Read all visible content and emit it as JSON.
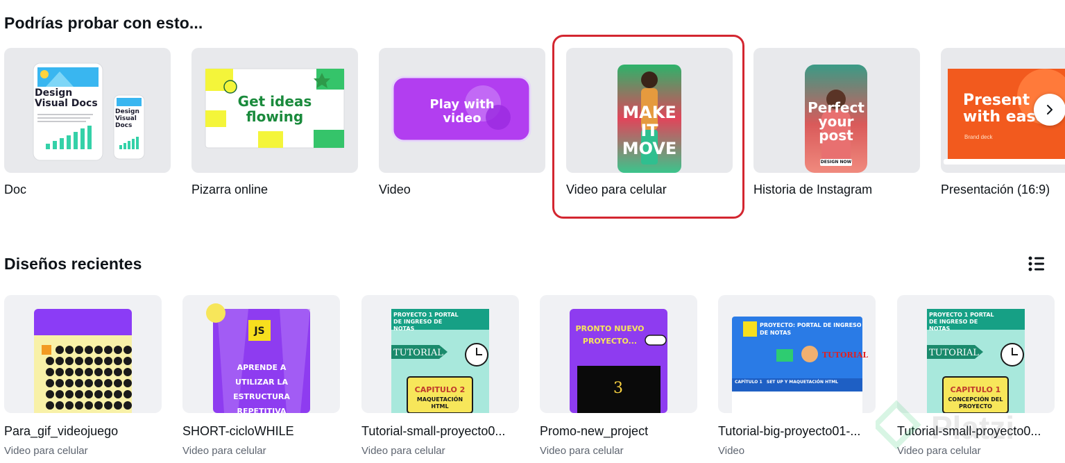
{
  "suggestions": {
    "title": "Podrías probar con esto...",
    "items": [
      {
        "label": "Doc",
        "thumb": "Design Visual Docs"
      },
      {
        "label": "Pizarra online",
        "thumb": "Get ideas flowing"
      },
      {
        "label": "Video",
        "thumb": "Play with video"
      },
      {
        "label": "Video para celular",
        "thumb": "MAKE IT MOVE"
      },
      {
        "label": "Historia de Instagram",
        "thumb": "Perfect your post"
      },
      {
        "label": "Presentación (16:9)",
        "thumb": "Present with ease"
      }
    ],
    "thumb_extra": {
      "doc_small": "Design Visual Docs",
      "insta_cta": "DESIGN NOW",
      "pres_sub": "Brand deck"
    },
    "next_icon": "chevron-right-icon"
  },
  "recent": {
    "title": "Diseños recientes",
    "view_icon": "list-view-icon",
    "items": [
      {
        "title": "Para_gif_videojuego",
        "type": "Video para celular"
      },
      {
        "title": "SHORT-cicloWHILE",
        "type": "Video para celular"
      },
      {
        "title": "Tutorial-small-proyecto0...",
        "type": "Video para celular"
      },
      {
        "title": "Promo-new_project",
        "type": "Video para celular"
      },
      {
        "title": "Tutorial-big-proyecto01-...",
        "type": "Video"
      },
      {
        "title": "Tutorial-small-proyecto0...",
        "type": "Video para celular"
      }
    ],
    "thumbs": {
      "js_badge": "JS",
      "while_text": "APRENDE A UTILIZAR LA ESTRUCTURA REPETITIVA",
      "proj_header": "PROYECTO 1 PORTAL DE INGRESO DE NOTAS",
      "tutorial": "TUTORIAL",
      "cap2": "CAPITULO 2",
      "cap2_sub": "MAQUETACIÓN HTML",
      "promo": "PRONTO NUEVO PROYECTO...",
      "promo_count": "3",
      "big_header": "PROYECTO: PORTAL DE INGRESO DE NOTAS",
      "big_tutorial": "TUTORIAL",
      "big_footer": "CAPÍTULO 1   SET UP Y MAQUETACIÓN HTML",
      "cap1": "CAPITULO 1",
      "cap1_sub": "CONCEPCIÓN DEL PROYECTO"
    }
  },
  "watermark": {
    "text": "Platzi"
  },
  "colors": {
    "highlight": "#d32630",
    "purple": "#8b3cf6",
    "teal": "#9fe3d4"
  }
}
